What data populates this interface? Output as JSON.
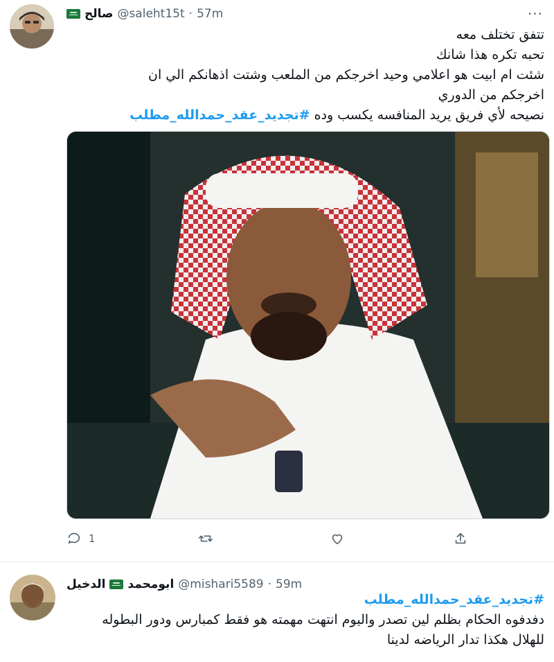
{
  "tweets": [
    {
      "author": {
        "name": "صالح",
        "handle": "@saleht15t",
        "time": "57m",
        "flag": "flag-icon-sa"
      },
      "lines": [
        "تتفق تختلف معه",
        "تحبه تكره هذا شانك",
        "شئت ام ابيت هو اعلامي وحيد  اخرجكم من الملعب وشتت اذهانكم الي ان",
        "اخرجكم من الدوري"
      ],
      "last_line_prefix": "نصيحه لأي فريق يريد المنافسه يكسب وده",
      "hashtag": "#تجديد_عقد_حمدالله_مطلب",
      "more": "···",
      "actions": {
        "reply_count": "1",
        "retweet_count": "",
        "like_count": ""
      }
    },
    {
      "author": {
        "name": "ابومحمد",
        "name2": "الدخيل",
        "handle": "@mishari5589",
        "time": "59m",
        "flag": "flag-icon-sa"
      },
      "hashtag": "#تجديد_عقد_حمدالله_مطلب",
      "lines": [
        "دفدفوه الحكام بظلم لين تصدر واليوم انتهت مهمته هو فقط كمبارس ودور البطوله",
        "للهلال هكذا تدار الرياضه لدينا"
      ]
    }
  ],
  "colors": {
    "link": "#1d9bf0",
    "muted": "#536471",
    "text": "#0f1419"
  }
}
